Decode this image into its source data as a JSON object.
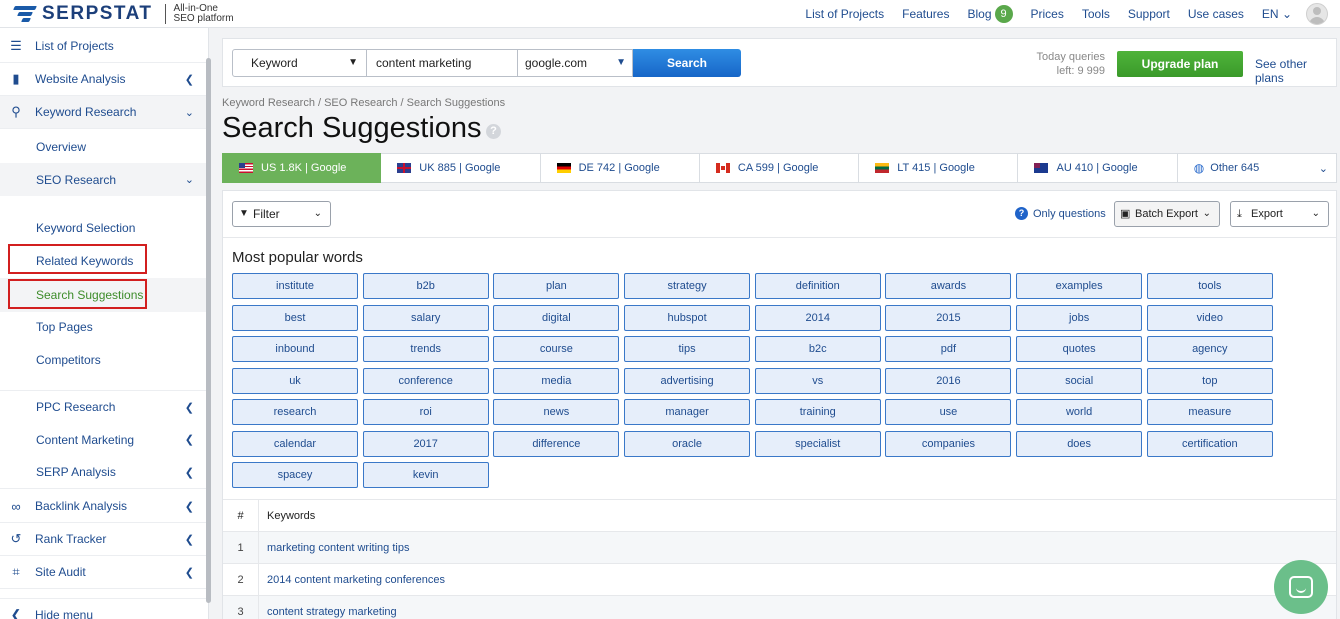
{
  "header": {
    "logo_text": "SERPSTAT",
    "tagline_1": "All-in-One",
    "tagline_2": "SEO platform",
    "nav": [
      "List of Projects",
      "Features",
      "Blog",
      "Prices",
      "Tools",
      "Support",
      "Use cases"
    ],
    "blog_badge": "9",
    "lang": "EN"
  },
  "sidebar": {
    "list_of_projects": "List of Projects",
    "website_analysis": "Website Analysis",
    "keyword_research": "Keyword Research",
    "overview": "Overview",
    "seo_research": "SEO Research",
    "keyword_selection": "Keyword Selection",
    "related_keywords": "Related Keywords",
    "search_suggestions": "Search Suggestions",
    "top_pages": "Top Pages",
    "competitors": "Competitors",
    "ppc_research": "PPC Research",
    "content_marketing": "Content Marketing",
    "serp_analysis": "SERP Analysis",
    "backlink_analysis": "Backlink Analysis",
    "rank_tracker": "Rank Tracker",
    "site_audit": "Site Audit",
    "hide_menu": "Hide menu"
  },
  "search": {
    "type": "Keyword",
    "query": "content marketing",
    "database": "google.com",
    "button": "Search",
    "queries_label": "Today queries",
    "queries_left": "left: 9 999",
    "upgrade": "Upgrade plan",
    "other_plans": "See other plans"
  },
  "breadcrumb": "Keyword Research / SEO Research / Search Suggestions",
  "page_title": "Search Suggestions",
  "db_tabs": [
    "US 1.8K | Google",
    "UK 885 | Google",
    "DE 742 | Google",
    "CA 599 | Google",
    "LT 415 | Google",
    "AU 410 | Google",
    "Other 645"
  ],
  "toolbar": {
    "filter": "Filter",
    "only_questions": "Only questions",
    "batch_export": "Batch Export",
    "export": "Export"
  },
  "popular_words": {
    "title": "Most popular words",
    "words": [
      "institute",
      "b2b",
      "plan",
      "strategy",
      "definition",
      "awards",
      "examples",
      "tools",
      "best",
      "salary",
      "digital",
      "hubspot",
      "2014",
      "2015",
      "jobs",
      "video",
      "inbound",
      "trends",
      "course",
      "tips",
      "b2c",
      "pdf",
      "quotes",
      "agency",
      "uk",
      "conference",
      "media",
      "advertising",
      "vs",
      "2016",
      "social",
      "top",
      "research",
      "roi",
      "news",
      "manager",
      "training",
      "use",
      "world",
      "measure",
      "calendar",
      "2017",
      "difference",
      "oracle",
      "specialist",
      "companies",
      "does",
      "certification",
      "spacey",
      "kevin"
    ]
  },
  "table": {
    "col_num": "#",
    "col_keywords": "Keywords",
    "rows": [
      {
        "num": "1",
        "keyword": "marketing content writing tips"
      },
      {
        "num": "2",
        "keyword": "2014 content marketing conferences"
      },
      {
        "num": "3",
        "keyword": "content strategy marketing"
      }
    ]
  }
}
